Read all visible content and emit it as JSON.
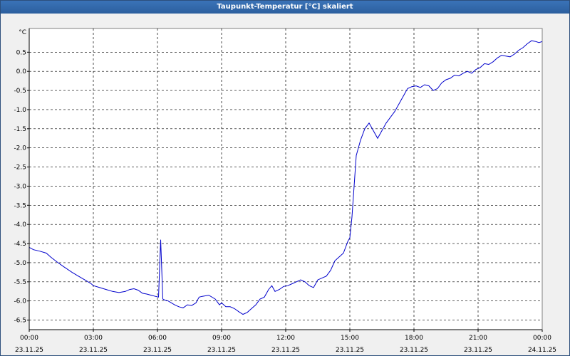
{
  "window": {
    "title": "Taupunkt-Temperatur [°C] skaliert"
  },
  "chart_data": {
    "type": "line",
    "title": "Taupunkt-Temperatur [°C] skaliert",
    "ylabel": "°C",
    "xlabel": "",
    "ylim": [
      -6.75,
      1.12
    ],
    "xlim": [
      0,
      24
    ],
    "grid": true,
    "colors": {
      "series": "#0000cc",
      "grid": "#000000",
      "plot_bg": "#ffffff"
    },
    "y_ticks": [
      {
        "value": 0.5,
        "label": "0.5"
      },
      {
        "value": 0.0,
        "label": "0.0"
      },
      {
        "value": -0.5,
        "label": "-0.5"
      },
      {
        "value": -1.0,
        "label": "-1.0"
      },
      {
        "value": -1.5,
        "label": "-1.5"
      },
      {
        "value": -2.0,
        "label": "-2.0"
      },
      {
        "value": -2.5,
        "label": "-2.5"
      },
      {
        "value": -3.0,
        "label": "-3.0"
      },
      {
        "value": -3.5,
        "label": "-3.5"
      },
      {
        "value": -4.0,
        "label": "-4.0"
      },
      {
        "value": -4.5,
        "label": "-4.5"
      },
      {
        "value": -5.0,
        "label": "-5.0"
      },
      {
        "value": -5.5,
        "label": "-5.5"
      },
      {
        "value": -6.0,
        "label": "-6.0"
      },
      {
        "value": -6.5,
        "label": "-6.5"
      }
    ],
    "x_ticks": [
      {
        "value": 0,
        "time": "00:00",
        "date": "23.11.25"
      },
      {
        "value": 3,
        "time": "03:00",
        "date": "23.11.25"
      },
      {
        "value": 6,
        "time": "06:00",
        "date": "23.11.25"
      },
      {
        "value": 9,
        "time": "09:00",
        "date": "23.11.25"
      },
      {
        "value": 12,
        "time": "12:00",
        "date": "23.11.25"
      },
      {
        "value": 15,
        "time": "15:00",
        "date": "23.11.25"
      },
      {
        "value": 18,
        "time": "18:00",
        "date": "23.11.25"
      },
      {
        "value": 21,
        "time": "21:00",
        "date": "23.11.25"
      },
      {
        "value": 24,
        "time": "00:00",
        "date": "24.11.25"
      }
    ],
    "series": [
      {
        "x": [
          0.0,
          0.2,
          0.5,
          0.8,
          1.0,
          1.3,
          1.6,
          2.0,
          2.3,
          2.6,
          2.9,
          3.0,
          3.3,
          3.6,
          3.9,
          4.2,
          4.5,
          4.7,
          4.9,
          5.1,
          5.3,
          5.5,
          5.7,
          5.9,
          6.05,
          6.15,
          6.25,
          6.35,
          6.5,
          6.8,
          7.0,
          7.2,
          7.4,
          7.6,
          7.8,
          7.95,
          8.1,
          8.4,
          8.7,
          8.9,
          9.0,
          9.2,
          9.4,
          9.6,
          9.8,
          10.0,
          10.2,
          10.4,
          10.6,
          10.8,
          11.0,
          11.2,
          11.35,
          11.5,
          11.7,
          11.9,
          12.1,
          12.3,
          12.5,
          12.7,
          12.9,
          13.1,
          13.3,
          13.5,
          13.7,
          13.9,
          14.1,
          14.3,
          14.5,
          14.7,
          14.9,
          15.0,
          15.1,
          15.2,
          15.3,
          15.5,
          15.7,
          15.9,
          16.1,
          16.3,
          16.5,
          16.7,
          16.9,
          17.1,
          17.3,
          17.5,
          17.7,
          17.9,
          18.1,
          18.3,
          18.5,
          18.7,
          18.9,
          19.1,
          19.3,
          19.5,
          19.7,
          19.9,
          20.1,
          20.3,
          20.5,
          20.7,
          20.9,
          21.1,
          21.3,
          21.5,
          21.7,
          21.9,
          22.1,
          22.3,
          22.5,
          22.7,
          22.9,
          23.1,
          23.3,
          23.5,
          23.7,
          23.85,
          24.0
        ],
        "y": [
          -4.6,
          -4.66,
          -4.7,
          -4.75,
          -4.85,
          -4.98,
          -5.1,
          -5.25,
          -5.35,
          -5.45,
          -5.55,
          -5.6,
          -5.65,
          -5.7,
          -5.75,
          -5.78,
          -5.75,
          -5.7,
          -5.68,
          -5.72,
          -5.8,
          -5.82,
          -5.85,
          -5.88,
          -5.9,
          -4.4,
          -5.95,
          -5.98,
          -6.0,
          -6.1,
          -6.15,
          -6.18,
          -6.1,
          -6.12,
          -6.05,
          -5.9,
          -5.88,
          -5.85,
          -5.95,
          -6.1,
          -6.05,
          -6.15,
          -6.15,
          -6.2,
          -6.28,
          -6.35,
          -6.3,
          -6.2,
          -6.1,
          -5.95,
          -5.9,
          -5.7,
          -5.6,
          -5.75,
          -5.7,
          -5.62,
          -5.6,
          -5.55,
          -5.5,
          -5.45,
          -5.5,
          -5.6,
          -5.65,
          -5.45,
          -5.4,
          -5.35,
          -5.2,
          -4.95,
          -4.85,
          -4.75,
          -4.45,
          -4.35,
          -3.8,
          -3.0,
          -2.2,
          -1.8,
          -1.5,
          -1.35,
          -1.55,
          -1.75,
          -1.55,
          -1.35,
          -1.2,
          -1.05,
          -0.85,
          -0.65,
          -0.45,
          -0.4,
          -0.38,
          -0.42,
          -0.35,
          -0.38,
          -0.5,
          -0.45,
          -0.3,
          -0.22,
          -0.18,
          -0.1,
          -0.12,
          -0.05,
          0.0,
          -0.05,
          0.05,
          0.1,
          0.2,
          0.18,
          0.25,
          0.35,
          0.42,
          0.4,
          0.38,
          0.45,
          0.55,
          0.62,
          0.72,
          0.8,
          0.78,
          0.75,
          0.78
        ]
      }
    ]
  }
}
